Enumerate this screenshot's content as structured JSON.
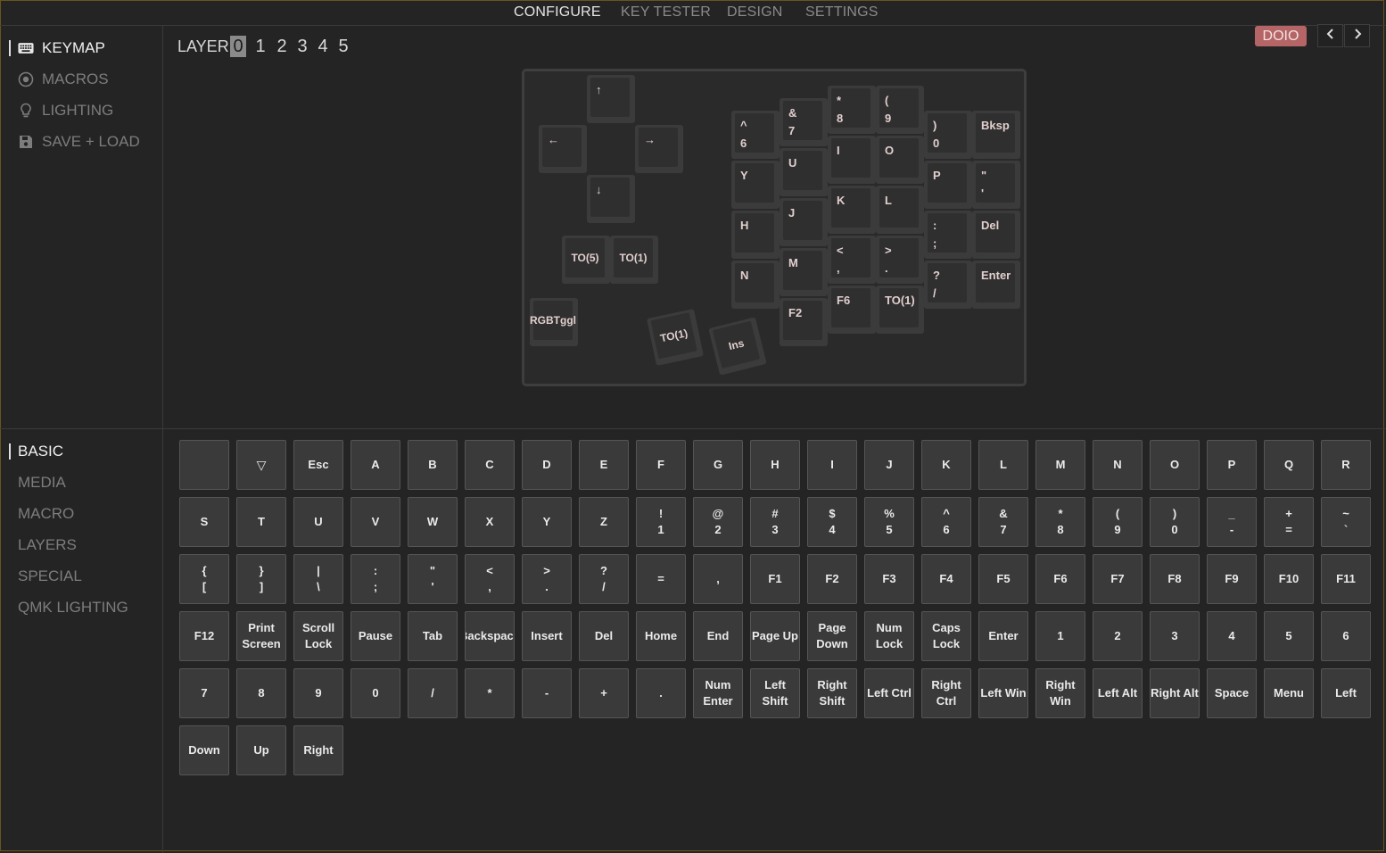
{
  "top_tabs": [
    "CONFIGURE",
    "KEY TESTER",
    "DESIGN",
    "SETTINGS"
  ],
  "top_tabs_active": "CONFIGURE",
  "sidebar_top": [
    {
      "label": "KEYMAP",
      "icon": "keyboard-icon",
      "active": true
    },
    {
      "label": "MACROS",
      "icon": "record-icon",
      "active": false
    },
    {
      "label": "LIGHTING",
      "icon": "lightbulb-icon",
      "active": false
    },
    {
      "label": "SAVE + LOAD",
      "icon": "floppy-disk-icon",
      "active": false
    }
  ],
  "sidebar_bottom": [
    {
      "label": "BASIC",
      "active": true
    },
    {
      "label": "MEDIA",
      "active": false
    },
    {
      "label": "MACRO",
      "active": false
    },
    {
      "label": "LAYERS",
      "active": false
    },
    {
      "label": "SPECIAL",
      "active": false
    },
    {
      "label": "QMK LIGHTING",
      "active": false
    }
  ],
  "layer": {
    "label": "LAYER",
    "numbers": [
      "0",
      "1",
      "2",
      "3",
      "4",
      "5"
    ],
    "active": "0"
  },
  "device_badge": "DOIO",
  "colors": {
    "background": "#242424",
    "accent": "#b56566",
    "frame": "#6a5418"
  },
  "keyboard_keys": [
    {
      "label": "↑",
      "align": "top"
    },
    {
      "label": "←",
      "align": "top"
    },
    {
      "label": "→",
      "align": "top"
    },
    {
      "label": "↓",
      "align": "top"
    },
    {
      "label": "TO(5)",
      "align": "center"
    },
    {
      "label": "TO(1)",
      "align": "center"
    },
    {
      "label": "RGBTggl",
      "align": "center"
    },
    {
      "label": "TO(1)",
      "align": "center"
    },
    {
      "label": "Ins",
      "align": "center"
    },
    {
      "label": "^\n6",
      "align": "top"
    },
    {
      "label": "Y",
      "align": "top"
    },
    {
      "label": "H",
      "align": "top"
    },
    {
      "label": "N",
      "align": "top"
    },
    {
      "label": "&\n7",
      "align": "top"
    },
    {
      "label": "U",
      "align": "top"
    },
    {
      "label": "J",
      "align": "top"
    },
    {
      "label": "M",
      "align": "top"
    },
    {
      "label": "F2",
      "align": "top"
    },
    {
      "label": "*\n8",
      "align": "top"
    },
    {
      "label": "I",
      "align": "top"
    },
    {
      "label": "K",
      "align": "top"
    },
    {
      "label": "<\n,",
      "align": "top"
    },
    {
      "label": "F6",
      "align": "top"
    },
    {
      "label": "(\n9",
      "align": "top"
    },
    {
      "label": "O",
      "align": "top"
    },
    {
      "label": "L",
      "align": "top"
    },
    {
      "label": ">\n.",
      "align": "top"
    },
    {
      "label": "TO(1)",
      "align": "top"
    },
    {
      "label": ")\n0",
      "align": "top"
    },
    {
      "label": "P",
      "align": "top"
    },
    {
      "label": ":\n;",
      "align": "top"
    },
    {
      "label": "?\n/",
      "align": "top"
    },
    {
      "label": "Bksp",
      "align": "top"
    },
    {
      "label": "\"\n'",
      "align": "top"
    },
    {
      "label": "Del",
      "align": "top"
    },
    {
      "label": "Enter",
      "align": "top"
    }
  ],
  "palette_keys": [
    "",
    "▽",
    "Esc",
    "A",
    "B",
    "C",
    "D",
    "E",
    "F",
    "G",
    "H",
    "I",
    "J",
    "K",
    "L",
    "M",
    "N",
    "O",
    "P",
    "Q",
    "R",
    "S",
    "T",
    "U",
    "V",
    "W",
    "X",
    "Y",
    "Z",
    "!\n1",
    "@\n2",
    "#\n3",
    "$\n4",
    "%\n5",
    "^\n6",
    "&\n7",
    "*\n8",
    "(\n9",
    ")\n0",
    "_\n-",
    "+\n=",
    "~\n`",
    "{\n[",
    "}\n]",
    "|\n\\",
    ":\n;",
    "\"\n'",
    "<\n,",
    ">\n.",
    "?\n/",
    "=",
    ",",
    "F1",
    "F2",
    "F3",
    "F4",
    "F5",
    "F6",
    "F7",
    "F8",
    "F9",
    "F10",
    "F11",
    "F12",
    "Print\nScreen",
    "Scroll\nLock",
    "Pause",
    "Tab",
    "Backspace",
    "Insert",
    "Del",
    "Home",
    "End",
    "Page Up",
    "Page\nDown",
    "Num\nLock",
    "Caps\nLock",
    "Enter",
    "1",
    "2",
    "3",
    "4",
    "5",
    "6",
    "7",
    "8",
    "9",
    "0",
    "/",
    "*",
    "-",
    "+",
    ".",
    "Num\nEnter",
    "Left\nShift",
    "Right\nShift",
    "Left Ctrl",
    "Right\nCtrl",
    "Left Win",
    "Right\nWin",
    "Left Alt",
    "Right Alt",
    "Space",
    "Menu",
    "Left",
    "Down",
    "Up",
    "Right"
  ]
}
